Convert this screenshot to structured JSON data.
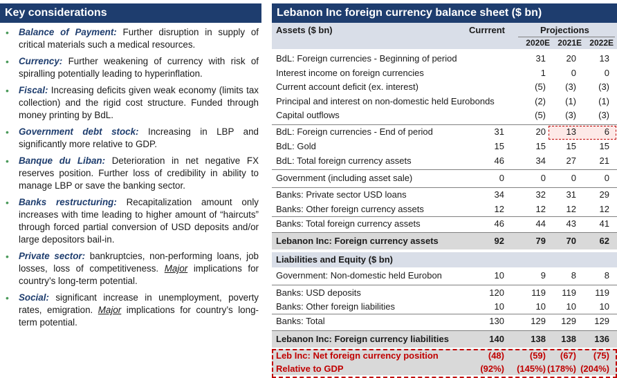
{
  "left": {
    "title": "Key considerations",
    "items": [
      {
        "term": "Balance of Payment:",
        "text": " Further disruption in supply of critical materials such a medical resources."
      },
      {
        "term": "Currency:",
        "text": " Further weakening of currency with risk of spiralling potentially leading to hyperinflation."
      },
      {
        "term": "Fiscal:",
        "text": " Increasing deficits given weak economy (limits tax collection) and the rigid cost structure. Funded through money printing by BdL."
      },
      {
        "term": "Government debt stock:",
        "text": " Increasing in LBP and significantly more relative to GDP."
      },
      {
        "term": "Banque du Liban:",
        "text": " Deterioration in net negative FX reserves position. Further loss of credibility in ability to manage LBP or save the banking sector."
      },
      {
        "term": "Banks restructuring:",
        "text": " Recapitalization amount only increases with time leading to higher amount of “haircuts” through forced partial conversion of USD deposits and/or large depositors bail-in."
      },
      {
        "term": "Private sector:",
        "text": " bankruptcies, non-performing loans, job losses, loss of competitiveness.",
        "em": "Major",
        "tail": " implications for country’s long-term potential."
      },
      {
        "term": "Social:",
        "text": " significant increase in unemployment, poverty rates, emigration.",
        "em": "Major",
        "tail": " implications for country’s long-term potential."
      }
    ]
  },
  "right": {
    "title": "Lebanon Inc foreign currency balance sheet ($ bn)",
    "assets_header": "Assets ($ bn)",
    "current_header": "Currrent",
    "projections_header": "Projections",
    "years": [
      "2020E",
      "2021E",
      "2022E"
    ],
    "rows_a": [
      {
        "label": "BdL: Foreign currencies - Beginning of period",
        "cur": "",
        "v": [
          "31",
          "20",
          "13"
        ]
      },
      {
        "label": "Interest income on foreign currencies",
        "cur": "",
        "v": [
          "1",
          "0",
          "0"
        ]
      },
      {
        "label": "Current account deficit (ex. interest)",
        "cur": "",
        "v": [
          "(5)",
          "(3)",
          "(3)"
        ]
      },
      {
        "label": "Principal and interest on non-domestic held Eurobonds",
        "cur": "",
        "v": [
          "(2)",
          "(1)",
          "(1)"
        ]
      },
      {
        "label": "Capital outflows",
        "cur": "",
        "v": [
          "(5)",
          "(3)",
          "(3)"
        ]
      }
    ],
    "rows_b": [
      {
        "label": "BdL: Foreign currencies - End of period",
        "cur": "31",
        "v": [
          "20",
          "13",
          "6"
        ]
      },
      {
        "label": "BdL: Gold",
        "cur": "15",
        "v": [
          "15",
          "15",
          "15"
        ]
      },
      {
        "label": "BdL: Total foreign currency assets",
        "cur": "46",
        "v": [
          "34",
          "27",
          "21"
        ]
      }
    ],
    "row_gov": {
      "label": "Government (including asset sale)",
      "cur": "0",
      "v": [
        "0",
        "0",
        "0"
      ]
    },
    "rows_banks": [
      {
        "label": "Banks: Private sector USD loans",
        "cur": "34",
        "v": [
          "32",
          "31",
          "29"
        ]
      },
      {
        "label": "Banks: Other foreign currency assets",
        "cur": "12",
        "v": [
          "12",
          "12",
          "12"
        ]
      }
    ],
    "row_banks_total": {
      "label": "Banks: Total foreign currency assets",
      "cur": "46",
      "v": [
        "44",
        "43",
        "41"
      ]
    },
    "assets_total": {
      "label": "Lebanon Inc: Foreign currency assets",
      "cur": "92",
      "v": [
        "79",
        "70",
        "62"
      ]
    },
    "liab_header": "Liabilities and Equity ($ bn)",
    "rows_l": [
      {
        "label": "Government: Non-domestic held Eurobon",
        "cur": "10",
        "v": [
          "9",
          "8",
          "8"
        ]
      },
      {
        "label": "Banks: USD deposits",
        "cur": "120",
        "v": [
          "119",
          "119",
          "119"
        ]
      },
      {
        "label": "Banks: Other foreign liabilities",
        "cur": "10",
        "v": [
          "10",
          "10",
          "10"
        ]
      },
      {
        "label": "Banks: Total",
        "cur": "130",
        "v": [
          "129",
          "129",
          "129"
        ]
      }
    ],
    "liab_total": {
      "label": "Lebanon Inc: Foreign currency liabilities",
      "cur": "140",
      "v": [
        "138",
        "138",
        "136"
      ]
    },
    "net": {
      "label": "Leb Inc: Net foreign currency position",
      "cur": "(48)",
      "v": [
        "(59)",
        "(67)",
        "(75)"
      ]
    },
    "gdp": {
      "label": "Relative to GDP",
      "cur": "(92%)",
      "v": [
        "(145%)",
        "(178%)",
        "(204%)"
      ]
    }
  }
}
